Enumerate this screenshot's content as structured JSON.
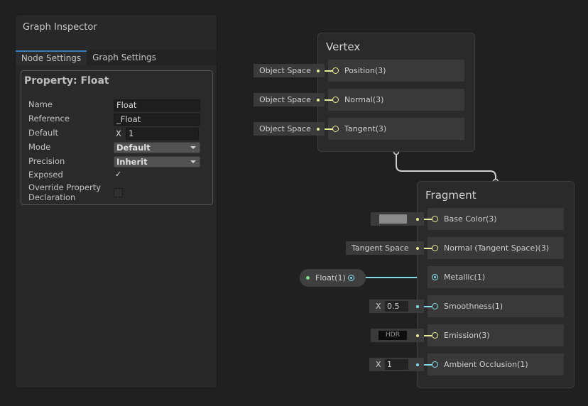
{
  "inspector": {
    "title": "Graph Inspector",
    "tabs": [
      {
        "label": "Node Settings",
        "active": true
      },
      {
        "label": "Graph Settings",
        "active": false
      }
    ],
    "property_title": "Property: Float",
    "fields": {
      "name_label": "Name",
      "name_value": "Float",
      "reference_label": "Reference",
      "reference_value": "_Float",
      "default_label": "Default",
      "default_axis": "X",
      "default_value": "1",
      "mode_label": "Mode",
      "mode_value": "Default",
      "precision_label": "Precision",
      "precision_value": "Inherit",
      "exposed_label": "Exposed",
      "exposed_checked": true,
      "exposed_mark": "✓",
      "override_label_line1": "Override Property",
      "override_label_line2": "Declaration",
      "override_checked": false
    }
  },
  "vertex": {
    "title": "Vertex",
    "slots": [
      {
        "label": "Position(3)",
        "input": "Object Space"
      },
      {
        "label": "Normal(3)",
        "input": "Object Space"
      },
      {
        "label": "Tangent(3)",
        "input": "Object Space"
      }
    ]
  },
  "fragment": {
    "title": "Fragment",
    "slots": [
      {
        "label": "Base Color(3)",
        "input_type": "color",
        "color": "#8a8a8a"
      },
      {
        "label": "Normal (Tangent Space)(3)",
        "input": "Tangent Space"
      },
      {
        "label": "Metallic(1)",
        "input_type": "connected"
      },
      {
        "label": "Smoothness(1)",
        "axis": "X",
        "value": "0.5"
      },
      {
        "label": "Emission(3)",
        "input": "HDR"
      },
      {
        "label": "Ambient Occlusion(1)",
        "axis": "X",
        "value": "1"
      }
    ]
  },
  "property_node": {
    "label": "Float(1)"
  },
  "colors": {
    "vector_port": "#e8eb9a",
    "float_port": "#85dae8",
    "accent_tab": "#3a79bb",
    "float_edge": "#85dae8"
  }
}
